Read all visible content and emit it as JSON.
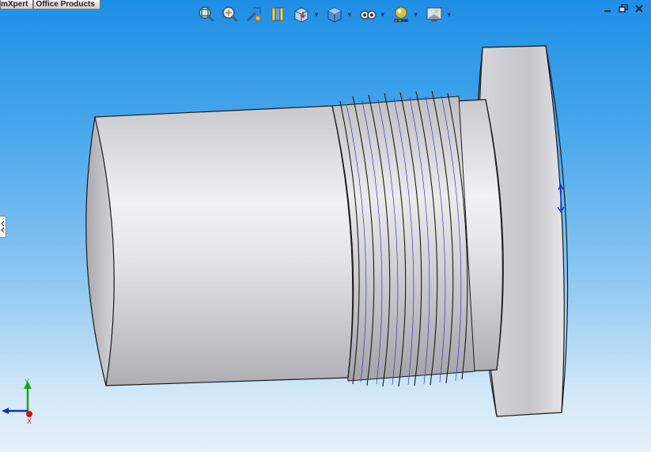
{
  "tabs": [
    "mXpert",
    "Office Products"
  ],
  "toolbar": {
    "icons": [
      "zoom-to-fit-icon",
      "zoom-to-area-icon",
      "previous-view-icon",
      "section-view-icon",
      "view-orientation-icon",
      "display-style-icon",
      "hide-show-items-icon",
      "edit-appearance-icon",
      "apply-scene-icon"
    ]
  },
  "window_controls": [
    "minimize-icon",
    "restore-icon",
    "close-icon"
  ],
  "triad": {
    "y_label": "Y",
    "x_label": "X"
  },
  "colors": {
    "viewport_top": "#1e8fe6",
    "viewport_bottom": "#e6f1f9",
    "model_face": "#d8d8dc",
    "model_edge": "#1a1a1a",
    "axis_y": "#1aa31a",
    "axis_x": "#d01010",
    "axis_z": "#1030c0"
  }
}
